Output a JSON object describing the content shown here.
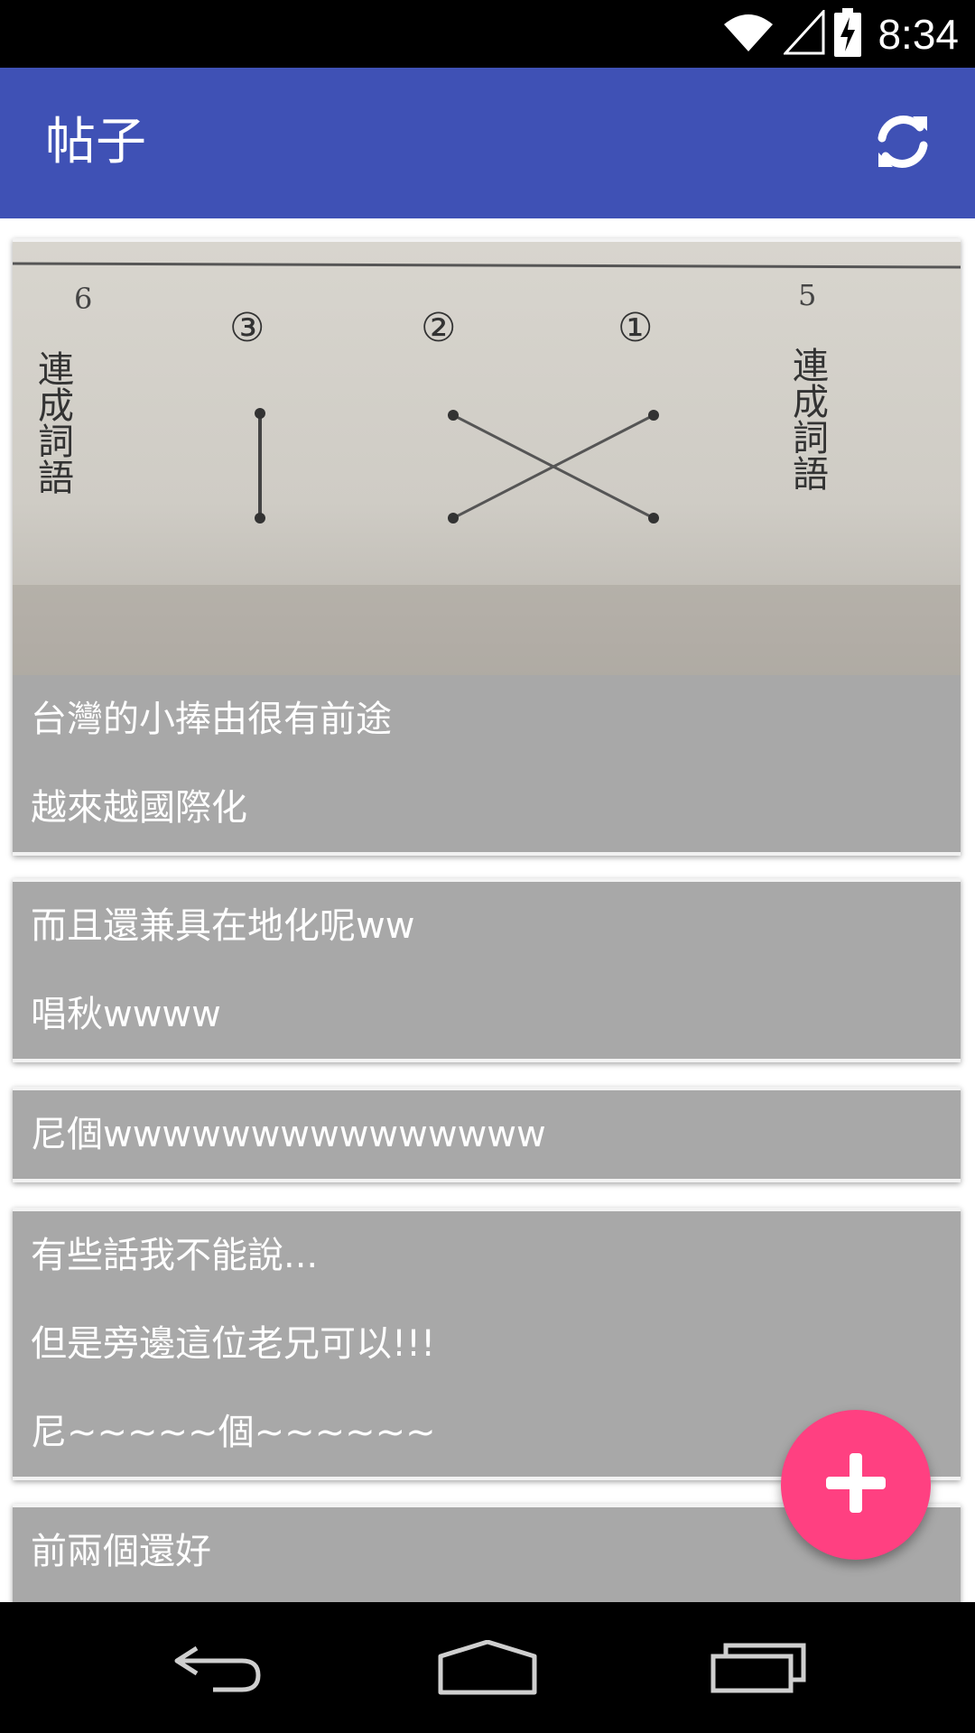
{
  "status_bar": {
    "time": "8:34",
    "icons": [
      "wifi-icon",
      "signal-icon",
      "battery-charging-icon"
    ]
  },
  "app_bar": {
    "title": "帖子",
    "refresh_icon": "refresh-icon",
    "color": "#3F51B5"
  },
  "posts": [
    {
      "has_image": true,
      "image_text": {
        "left_number": "6",
        "right_number": "5",
        "vertical_title": "連成詞語",
        "circles": [
          "③",
          "②",
          "①"
        ]
      },
      "lines": [
        "台灣的小捧由很有前途",
        "越來越國際化"
      ]
    },
    {
      "has_image": false,
      "lines": [
        "而且還兼具在地化呢ww",
        "唱秋wwww"
      ]
    },
    {
      "has_image": false,
      "lines": [
        "尼個wwwwwwwwwwwwwww"
      ]
    },
    {
      "has_image": false,
      "lines": [
        "有些話我不能說...",
        "但是旁邊這位老兄可以!!!",
        "尼~~~~~個~~~~~~"
      ]
    },
    {
      "has_image": false,
      "lines": [
        "前兩個還好"
      ]
    }
  ],
  "fab": {
    "icon": "add-icon",
    "color": "#FF4081"
  },
  "nav_bar": {
    "buttons": [
      "back-icon",
      "home-icon",
      "recents-icon"
    ]
  }
}
